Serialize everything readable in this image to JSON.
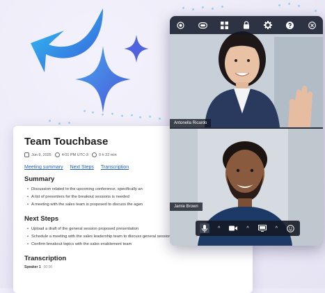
{
  "notes": {
    "title": "Team Touchbase",
    "meta": {
      "date": "Jun 9, 2025",
      "time": "4:01 PM UTC-3",
      "duration": "0 h 22 min"
    },
    "links": [
      "Meeting summary",
      "Next Steps",
      "Transcription"
    ],
    "summary": {
      "heading": "Summary",
      "items": [
        "Discussion related to the upcoming conference, specifically an",
        "A list of presenters for the breakout sessions is needed",
        "A meeting with the sales team is proposed to discuss the agen"
      ]
    },
    "next_steps": {
      "heading": "Next Steps",
      "items": [
        "Upload a draft of the general session proposed presentation",
        "Schedule a meeting with the sales leadership team to discuss general session topics",
        "Confirm breakout topics with the sales enablement team"
      ]
    },
    "transcription": {
      "heading": "Transcription",
      "speaker": "Speaker 1",
      "timestamp": "00:00"
    }
  },
  "call": {
    "participants": [
      {
        "name": "Antonella Ricardo"
      },
      {
        "name": "Jamie Brown"
      }
    ]
  },
  "colors": {
    "sparkle_start": "#2dc7f2",
    "sparkle_end": "#3b5bdb",
    "link": "#1f5fb8",
    "toolbar": "#121828"
  }
}
